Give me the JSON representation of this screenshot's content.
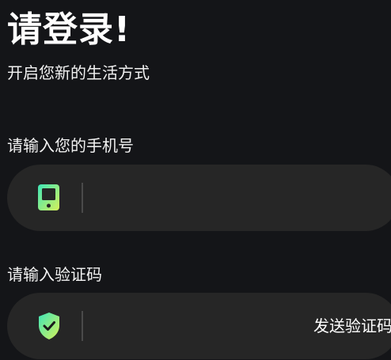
{
  "header": {
    "title": "请登录!",
    "subtitle": "开启您新的生活方式"
  },
  "phone": {
    "label": "请输入您的手机号",
    "value": "",
    "placeholder": "",
    "icon": "phone-icon"
  },
  "code": {
    "label": "请输入验证码",
    "value": "",
    "placeholder": "",
    "icon": "shield-check-icon",
    "send_label": "发送验证码"
  },
  "colors": {
    "background": "#141518",
    "input_background": "#262626",
    "accent_gradient_start": "#3ee6b8",
    "accent_gradient_end": "#d6f25a"
  }
}
